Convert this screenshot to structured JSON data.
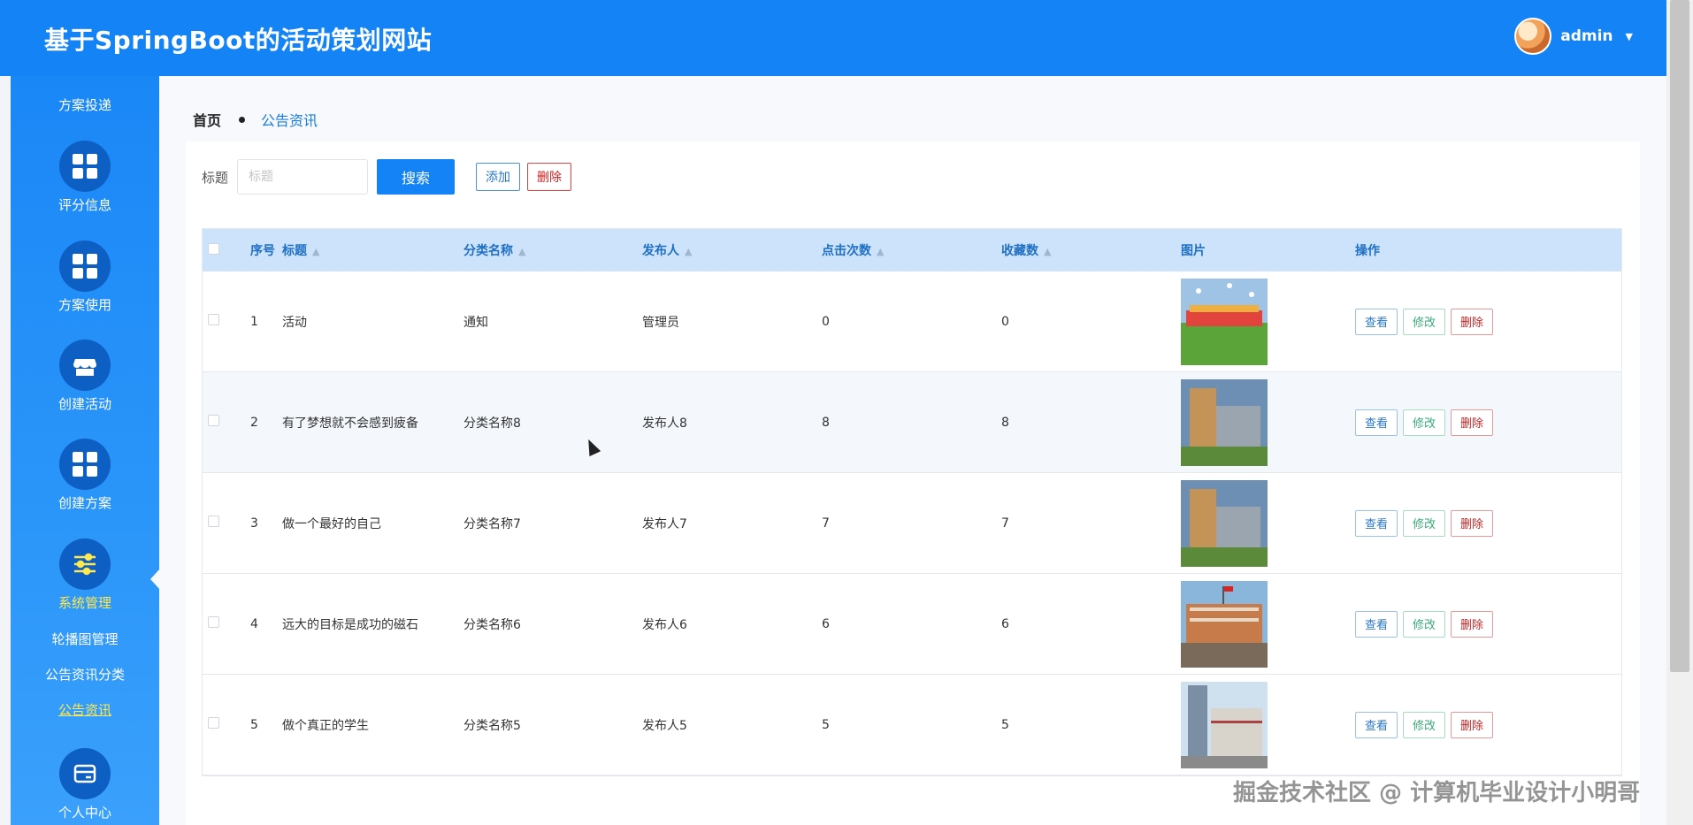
{
  "header": {
    "title": "基于SpringBoot的活动策划网站",
    "user_name": "admin"
  },
  "sidebar": {
    "top_label": "方案投递",
    "items": [
      {
        "label": "评分信息",
        "icon": "grid-icon"
      },
      {
        "label": "方案使用",
        "icon": "grid-icon"
      },
      {
        "label": "创建活动",
        "icon": "store-icon"
      },
      {
        "label": "创建方案",
        "icon": "grid-icon"
      },
      {
        "label": "系统管理",
        "icon": "sliders-icon",
        "active": true
      },
      {
        "label": "个人中心",
        "icon": "card-icon"
      }
    ],
    "sub_items": [
      {
        "label": "轮播图管理"
      },
      {
        "label": "公告资讯分类"
      },
      {
        "label": "公告资讯",
        "active": true
      }
    ]
  },
  "breadcrumb": {
    "home": "首页",
    "current": "公告资讯"
  },
  "search": {
    "label": "标题",
    "placeholder": "标题",
    "value": "",
    "search_button": "搜索",
    "add_button": "添加",
    "delete_button": "删除"
  },
  "table": {
    "columns": [
      "序号",
      "标题",
      "分类名称",
      "发布人",
      "点击次数",
      "收藏数",
      "图片",
      "操作"
    ],
    "rows": [
      {
        "idx": "1",
        "title": "活动",
        "category": "通知",
        "publisher": "管理员",
        "clicks": "0",
        "favorites": "0",
        "image": "crowd-on-grass-photo"
      },
      {
        "idx": "2",
        "title": "有了梦想就不会感到疲备",
        "category": "分类名称8",
        "publisher": "发布人8",
        "clicks": "8",
        "favorites": "8",
        "image": "campus-building-photo"
      },
      {
        "idx": "3",
        "title": "做一个最好的自己",
        "category": "分类名称7",
        "publisher": "发布人7",
        "clicks": "7",
        "favorites": "7",
        "image": "campus-building-photo"
      },
      {
        "idx": "4",
        "title": "远大的目标是成功的磁石",
        "category": "分类名称6",
        "publisher": "发布人6",
        "clicks": "6",
        "favorites": "6",
        "image": "school-with-flag-photo"
      },
      {
        "idx": "5",
        "title": "做个真正的学生",
        "category": "分类名称5",
        "publisher": "发布人5",
        "clicks": "5",
        "favorites": "5",
        "image": "tall-buildings-photo"
      }
    ],
    "actions": {
      "view": "查看",
      "edit": "修改",
      "delete": "删除"
    }
  },
  "watermark": "掘金技术社区 @ 计算机毕业设计小明哥",
  "colors": {
    "header": "#1483f5",
    "sidebar": "#1a87f7",
    "accent": "#1483f5",
    "table_header": "#cce3fb",
    "active_text": "#ffe94f"
  }
}
